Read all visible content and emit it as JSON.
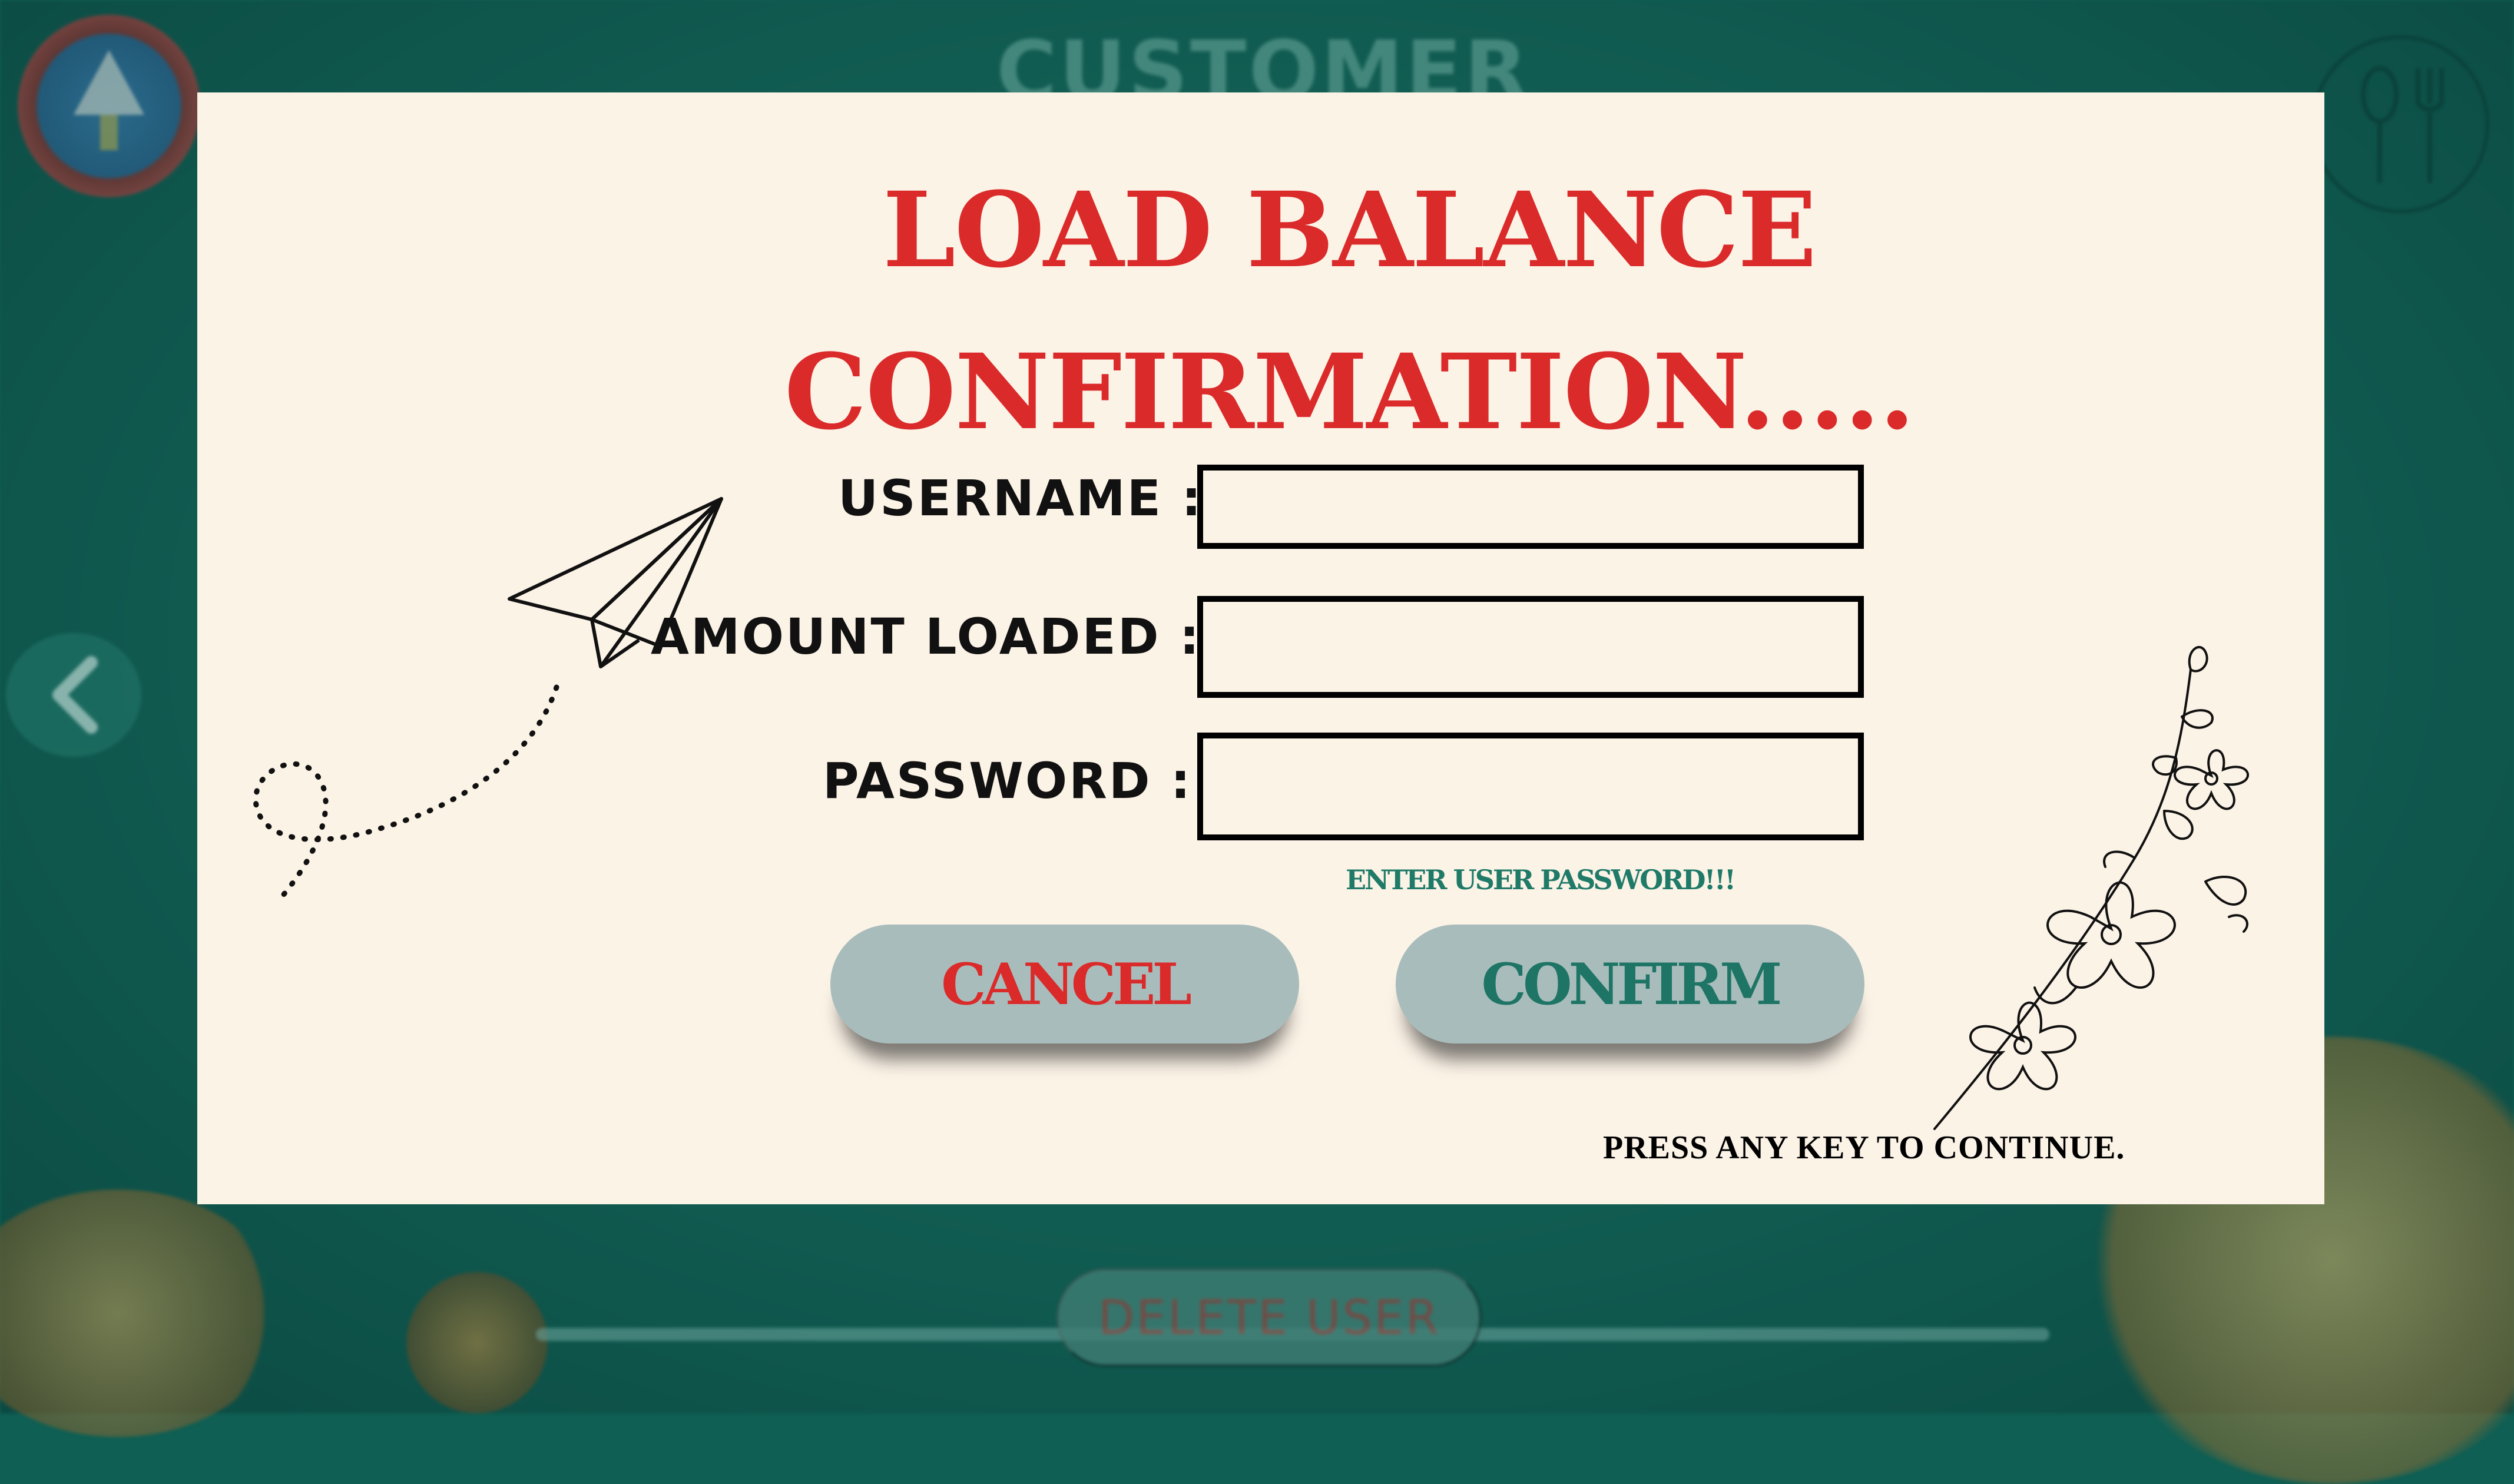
{
  "background": {
    "screen_title": "CUSTOMER ACCOUNT",
    "delete_user_label": "DELETE USER"
  },
  "dialog": {
    "title_line1": "LOAD BALANCE",
    "title_line2": "CONFIRMATION.....",
    "username_label": "USERNAME :",
    "username_value": "",
    "amount_label": "AMOUNT  LOADED  :",
    "amount_value": "",
    "password_label": "PASSWORD  :",
    "password_value": "",
    "password_hint": "ENTER USER PASSWORD!!!",
    "cancel_label": "CANCEL",
    "confirm_label": "CONFIRM",
    "footer_note": "PRESS ANY KEY TO CONTINUE."
  },
  "colors": {
    "background": "#0f5f54",
    "dialog_bg": "#fcf3e7",
    "title_red": "#da2a2a",
    "accent_green": "#1e7565",
    "button_bg": "#a9bcbc"
  },
  "icons": [
    "college-logo-icon",
    "fork-spoon-icon",
    "back-arrow-icon",
    "paper-plane-icon",
    "flower-sketch-icon"
  ]
}
